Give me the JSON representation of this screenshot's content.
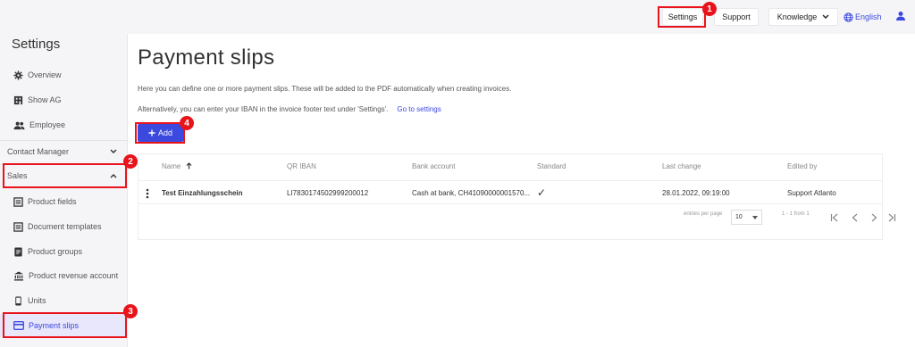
{
  "topbar": {
    "settings_label": "Settings",
    "support_label": "Support",
    "knowledge_label": "Knowledge",
    "language_label": "English",
    "icons": [
      "globe-icon",
      "user-icon",
      "chevron-down-icon"
    ]
  },
  "sidebar": {
    "title": "Settings",
    "items_top": [
      {
        "label": "Overview",
        "icon": "gear-icon"
      },
      {
        "label": "Show AG",
        "icon": "building-icon"
      },
      {
        "label": "Employee",
        "icon": "users-icon"
      }
    ],
    "sections": [
      {
        "label": "Contact Manager",
        "state": "collapsed"
      },
      {
        "label": "Sales",
        "state": "expanded"
      }
    ],
    "items_sales": [
      {
        "label": "Product fields",
        "icon": "list-icon"
      },
      {
        "label": "Document templates",
        "icon": "list-icon"
      },
      {
        "label": "Product groups",
        "icon": "document-icon"
      },
      {
        "label": "Product revenue account",
        "icon": "bank-icon"
      },
      {
        "label": "Units",
        "icon": "device-icon"
      },
      {
        "label": "Payment slips",
        "icon": "card-icon",
        "active": true
      }
    ]
  },
  "main": {
    "title": "Payment slips",
    "description": "Here you can define one or more payment slips. These will be added to the PDF automatically when creating invoices.",
    "note": "Alternatively, you can enter your IBAN in the invoice footer text under 'Settings'.",
    "note_link": "Go to settings",
    "add_label": "Add",
    "table": {
      "headers": [
        "Name",
        "QR IBAN",
        "Bank account",
        "Standard",
        "Last change",
        "Edited by"
      ],
      "rows": [
        {
          "name": "Test Einzahlungsschein",
          "qr_iban": "LI7830174502999200012",
          "bank_account": "Cash at bank, CH41090000001570...",
          "standard": "✓",
          "last_change": "28.01.2022, 09:19:00",
          "edited_by": "Support Atlanto"
        }
      ],
      "pagination": {
        "entries_label": "entries per page",
        "per_page": "10",
        "range": "1 - 1 from 1"
      }
    }
  },
  "annotations": {
    "badges": [
      "1",
      "2",
      "3",
      "4"
    ],
    "color": "#e8141c"
  },
  "colors": {
    "accent": "#3b49df",
    "sidebar_bg": "#f5f5f7",
    "active_bg": "#e8e7fb"
  }
}
